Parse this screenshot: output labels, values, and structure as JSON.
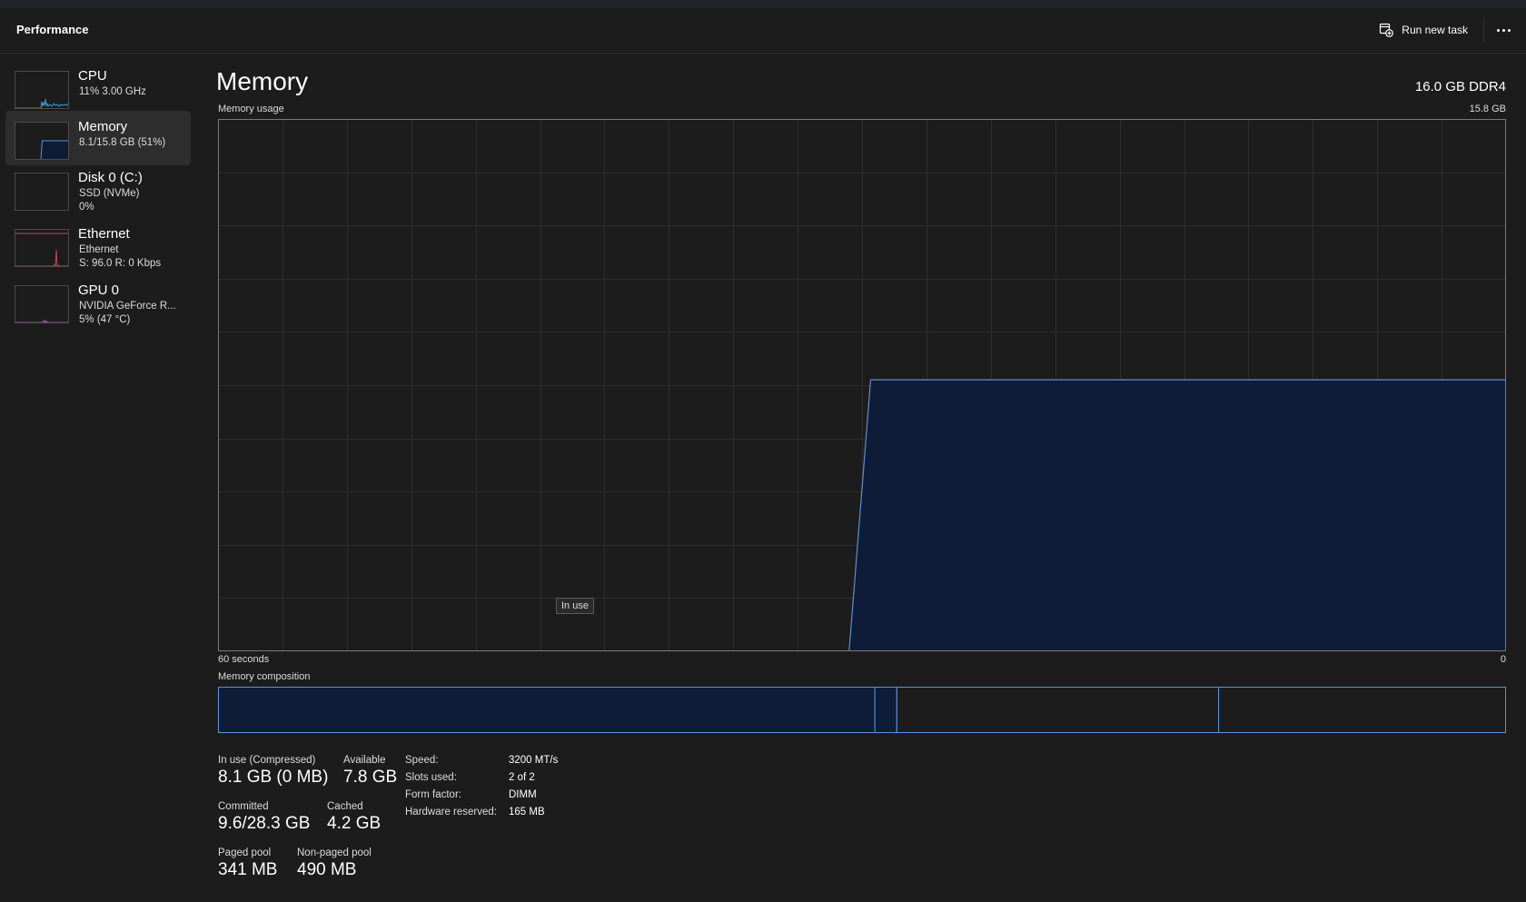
{
  "header": {
    "title": "Performance",
    "run_new_task": "Run new task"
  },
  "sidebar": {
    "items": [
      {
        "name": "CPU",
        "line1": "11% 3.00 GHz",
        "line2": ""
      },
      {
        "name": "Memory",
        "line1": "8.1/15.8 GB (51%)",
        "line2": ""
      },
      {
        "name": "Disk 0 (C:)",
        "line1": "SSD (NVMe)",
        "line2": "0%"
      },
      {
        "name": "Ethernet",
        "line1": "Ethernet",
        "line2": "S: 96.0 R: 0 Kbps"
      },
      {
        "name": "GPU 0",
        "line1": "NVIDIA GeForce R...",
        "line2": "5% (47 °C)"
      }
    ]
  },
  "main": {
    "title": "Memory",
    "spec": "16.0 GB DDR4",
    "usage_label": "Memory usage",
    "usage_max": "15.8 GB",
    "in_use_tooltip": "In use",
    "axis_left": "60 seconds",
    "axis_right": "0",
    "composition_label": "Memory composition",
    "stats": {
      "in_use": {
        "label": "In use (Compressed)",
        "value": "8.1 GB (0 MB)"
      },
      "available": {
        "label": "Available",
        "value": "7.8 GB"
      },
      "committed": {
        "label": "Committed",
        "value": "9.6/28.3 GB"
      },
      "cached": {
        "label": "Cached",
        "value": "4.2 GB"
      },
      "paged_pool": {
        "label": "Paged pool",
        "value": "341 MB"
      },
      "non_paged_pool": {
        "label": "Non-paged pool",
        "value": "490 MB"
      }
    },
    "specs": [
      {
        "key": "Speed:",
        "value": "3200 MT/s"
      },
      {
        "key": "Slots used:",
        "value": "2 of 2"
      },
      {
        "key": "Form factor:",
        "value": "DIMM"
      },
      {
        "key": "Hardware reserved:",
        "value": "165 MB"
      }
    ],
    "usage_history": {
      "unit": "fraction of 15.8 GB",
      "points": [
        [
          0,
          0
        ],
        [
          29.4,
          0
        ],
        [
          30.4,
          0.51
        ],
        [
          60,
          0.51
        ]
      ]
    },
    "composition": {
      "in_use_fraction": 0.51,
      "modified_fraction": 0.017,
      "standby_fraction": 0.25,
      "free_fraction": 0.223
    }
  },
  "colors": {
    "background": "#1c1c1c",
    "graph_line": "#5b8fd8",
    "graph_fill": "#0e1c38",
    "grid": "#2e2e2e"
  }
}
